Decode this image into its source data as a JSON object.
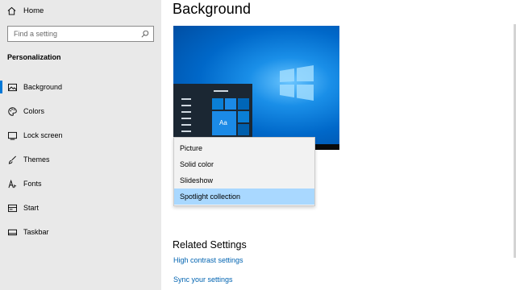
{
  "sidebar": {
    "home_label": "Home",
    "search": {
      "placeholder": "Find a setting"
    },
    "section_title": "Personalization",
    "items": [
      {
        "label": "Background",
        "icon": "picture-icon",
        "active": true
      },
      {
        "label": "Colors",
        "icon": "palette-icon",
        "active": false
      },
      {
        "label": "Lock screen",
        "icon": "lock-screen-icon",
        "active": false
      },
      {
        "label": "Themes",
        "icon": "brush-icon",
        "active": false
      },
      {
        "label": "Fonts",
        "icon": "font-icon",
        "active": false
      },
      {
        "label": "Start",
        "icon": "start-icon",
        "active": false
      },
      {
        "label": "Taskbar",
        "icon": "taskbar-icon",
        "active": false
      }
    ]
  },
  "main": {
    "title": "Background",
    "preview": {
      "tile_label": "Aa"
    },
    "background_dropdown": {
      "options": [
        "Picture",
        "Solid color",
        "Slideshow",
        "Spotlight collection"
      ],
      "selected": "Spotlight collection"
    },
    "related_settings": {
      "title": "Related Settings",
      "links": [
        "High contrast settings",
        "Sync your settings"
      ]
    }
  },
  "colors": {
    "accent": "#0078d7",
    "link": "#0063b1",
    "sidebar_bg": "#e9e9e9",
    "selected_option_bg": "#a9d8ff"
  }
}
